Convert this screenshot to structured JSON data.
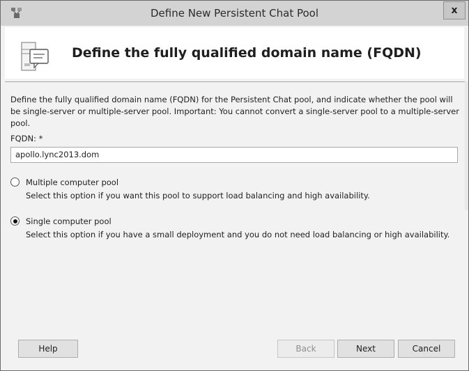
{
  "window": {
    "title": "Define New Persistent Chat Pool",
    "close_label": "x"
  },
  "header": {
    "title": "Define the fully qualified domain name (FQDN)"
  },
  "content": {
    "description": "Define the fully qualified domain name (FQDN) for the Persistent Chat pool, and indicate whether the pool will be single-server or multiple-server pool. Important: You cannot convert a single-server pool to a multiple-server pool.",
    "fqdn_label": "FQDN: *",
    "fqdn_value": "apollo.lync2013.dom",
    "options": [
      {
        "label": "Multiple computer pool",
        "description": "Select this option if you want this pool to support load balancing and high availability.",
        "selected": false
      },
      {
        "label": "Single computer pool",
        "description": "Select this option if you have a small deployment and you do not need load balancing or high availability.",
        "selected": true
      }
    ]
  },
  "footer": {
    "help_label": "Help",
    "back_label": "Back",
    "next_label": "Next",
    "cancel_label": "Cancel"
  }
}
